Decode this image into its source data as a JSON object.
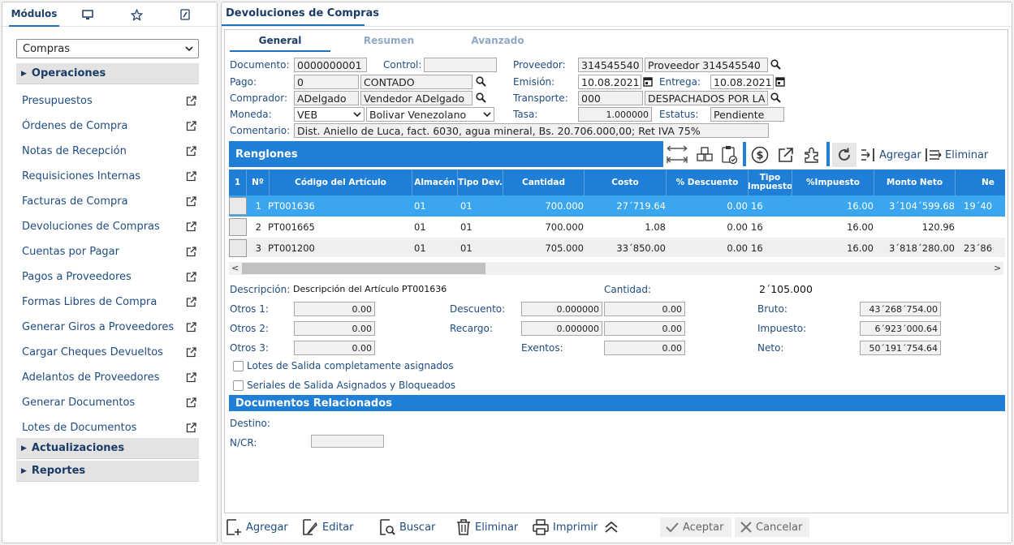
{
  "left_tabs": {
    "modules": "Módulos"
  },
  "module_select": {
    "value": "Compras"
  },
  "groups": {
    "operaciones": "Operaciones",
    "actualizaciones": "Actualizaciones",
    "reportes": "Reportes"
  },
  "menu": [
    "Presupuestos",
    "Órdenes de Compra",
    "Notas de Recepción",
    "Requisiciones Internas",
    "Facturas de Compra",
    "Devoluciones de Compras",
    "Cuentas por Pagar",
    "Pagos a Proveedores",
    "Formas Libres de Compra",
    "Generar Giros a Proveedores",
    "Cargar Cheques Devueltos",
    "Adelantos de Proveedores",
    "Generar Documentos",
    "Lotes de Documentos"
  ],
  "window": {
    "title": "Devoluciones de Compras"
  },
  "subtabs": {
    "general": "General",
    "resumen": "Resumen",
    "avanzado": "Avanzado"
  },
  "header": {
    "documento_label": "Documento:",
    "documento": "0000000001",
    "control_label": "Control:",
    "control": "",
    "proveedor_label": "Proveedor:",
    "proveedor_code": "314545540",
    "proveedor_name": "Proveedor 314545540",
    "pago_label": "Pago:",
    "pago_code": "0",
    "pago_name": "CONTADO",
    "emision_label": "Emisión:",
    "emision": "10.08.2021",
    "entrega_label": "Entrega:",
    "entrega": "10.08.2021",
    "comprador_label": "Comprador:",
    "comprador_code": "ADelgado",
    "comprador_name": "Vendedor ADelgado",
    "transporte_label": "Transporte:",
    "transporte_code": "000",
    "transporte_name": "DESPACHADOS POR LA",
    "moneda_label": "Moneda:",
    "moneda_code": "VEB",
    "moneda_name": "Bolivar Venezolano",
    "tasa_label": "Tasa:",
    "tasa": "1.000000",
    "estatus_label": "Estatus:",
    "estatus": "Pendiente",
    "comentario_label": "Comentario:",
    "comentario": "Dist. Aniello de Luca, fact. 6030, agua mineral, Bs. 20.706.000,00; Ret IVA 75%"
  },
  "renglones": {
    "title": "Renglones",
    "agregar": "Agregar",
    "eliminar": "Eliminar",
    "columns": {
      "sel": "1",
      "num": "Nº",
      "codigo": "Código del Artículo",
      "almacen": "Almacén",
      "tipo_dev": "Tipo Dev.",
      "cantidad": "Cantidad",
      "costo": "Costo",
      "descuento": "% Descuento",
      "tipo_impuesto": "Tipo Impuesto",
      "impuesto": "%Impuesto",
      "monto_neto": "Monto Neto",
      "neto": "Ne"
    },
    "rows": [
      {
        "num": "1",
        "codigo": "PT001636",
        "almacen": "01",
        "tipo_dev": "01",
        "cantidad": "700.000",
        "costo": "27´719.64",
        "descuento": "0.00",
        "tipo_impuesto": "16",
        "impuesto": "16.00",
        "monto": "3´104´599.68",
        "neto": "19´40"
      },
      {
        "num": "2",
        "codigo": "PT001665",
        "almacen": "01",
        "tipo_dev": "01",
        "cantidad": "700.000",
        "costo": "1.08",
        "descuento": "0.00",
        "tipo_impuesto": "16",
        "impuesto": "16.00",
        "monto": "120.96",
        "neto": ""
      },
      {
        "num": "3",
        "codigo": "PT001200",
        "almacen": "01",
        "tipo_dev": "01",
        "cantidad": "705.000",
        "costo": "33´850.00",
        "descuento": "0.00",
        "tipo_impuesto": "16",
        "impuesto": "16.00",
        "monto": "3´818´280.00",
        "neto": "23´86"
      }
    ]
  },
  "totals": {
    "descripcion_label": "Descripción:",
    "descripcion": "Descripción del Artículo PT001636",
    "cantidad_label": "Cantidad:",
    "cantidad": "2´105.000",
    "otros1_label": "Otros 1:",
    "otros1": "0.00",
    "otros2_label": "Otros 2:",
    "otros2": "0.00",
    "otros3_label": "Otros 3:",
    "otros3": "0.00",
    "descuento_label": "Descuento:",
    "descuento_pct": "0.000000",
    "descuento": "0.00",
    "recargo_label": "Recargo:",
    "recargo_pct": "0.000000",
    "recargo": "0.00",
    "exentos_label": "Exentos:",
    "exentos": "0.00",
    "bruto_label": "Bruto:",
    "bruto": "43´268´754.00",
    "impuesto_label": "Impuesto:",
    "impuesto": "6´923´000.64",
    "neto_label": "Neto:",
    "neto": "50´191´754.64"
  },
  "checks": {
    "lotes": "Lotes de Salida completamente asignados",
    "seriales": "Seriales de Salida Asignados y Bloqueados"
  },
  "docrel": {
    "title": "Documentos Relacionados",
    "destino_label": "Destino:",
    "ncr_label": "N/CR:",
    "ncr": ""
  },
  "bottom": {
    "agregar": "Agregar",
    "editar": "Editar",
    "buscar": "Buscar",
    "eliminar": "Eliminar",
    "imprimir": "Imprimir",
    "aceptar": "Aceptar",
    "cancelar": "Cancelar"
  }
}
